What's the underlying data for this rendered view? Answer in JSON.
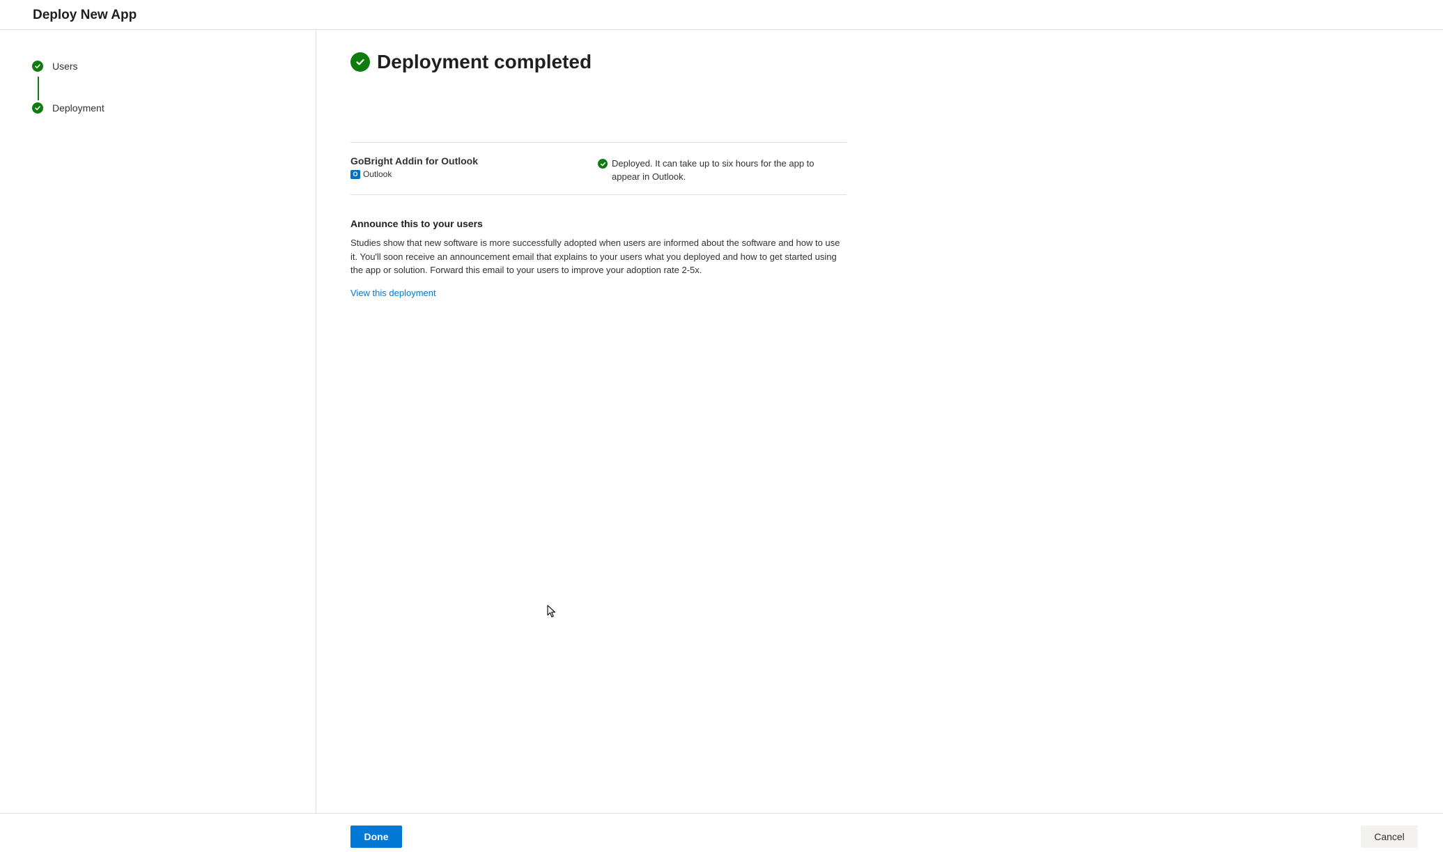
{
  "header": {
    "title": "Deploy New App"
  },
  "steps": [
    {
      "label": "Users",
      "state": "completed"
    },
    {
      "label": "Deployment",
      "state": "completed"
    }
  ],
  "main": {
    "title": "Deployment completed",
    "app": {
      "name": "GoBright Addin for Outlook",
      "platform": "Outlook",
      "platform_icon": "outlook-icon",
      "status": "Deployed. It can take up to six hours for the app to appear in Outlook."
    },
    "announce": {
      "heading": "Announce this to your users",
      "body": "Studies show that new software is more successfully adopted when users are informed about the software and how to use it. You'll soon receive an announcement email that explains to your users what you deployed and how to get started using the app or solution. Forward this email to your users to improve your adoption rate 2-5x.",
      "link": "View this deployment"
    }
  },
  "footer": {
    "done_label": "Done",
    "cancel_label": "Cancel"
  },
  "colors": {
    "success": "#107c10",
    "primary": "#0078d4",
    "border": "#e1dfdd"
  }
}
